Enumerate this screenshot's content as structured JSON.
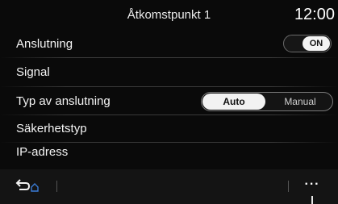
{
  "header": {
    "title": "Åtkomstpunkt 1",
    "clock": "12:00"
  },
  "settings": {
    "rows": [
      {
        "label": "Anslutning",
        "control": "toggle",
        "toggle_value": "ON"
      },
      {
        "label": "Signal"
      },
      {
        "label": "Typ av anslutning",
        "control": "segmented",
        "options": [
          "Auto",
          "Manual"
        ],
        "selected": "Auto"
      },
      {
        "label": "Säkerhetstyp"
      },
      {
        "label": "IP-adress"
      }
    ]
  },
  "bottom_bar": {
    "back_icon": "back-home-icon",
    "more_icon": "more-options-icon",
    "more_label": "···"
  },
  "colors": {
    "background": "#0a0a0a",
    "text": "#f4f4f4",
    "accent_selected": "#f2f2f2",
    "home_icon": "#3a7bd5"
  }
}
